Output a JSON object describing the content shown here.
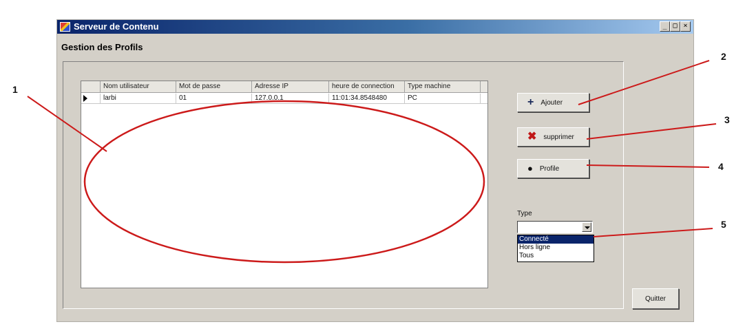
{
  "window": {
    "title": "Serveur de Contenu",
    "subtitle": "Gestion des Profils",
    "controls": [
      "_",
      "□",
      "×"
    ]
  },
  "grid": {
    "columns": [
      "Nom utilisateur",
      "Mot de passe",
      "Adresse IP",
      "heure de connection",
      "Type machine"
    ],
    "rows": [
      [
        "larbi",
        "01",
        "127.0.0.1",
        "11:01:34.8548480",
        "PC"
      ]
    ]
  },
  "buttons": {
    "ajouter": {
      "label": "Ajouter",
      "icon": "plus-icon"
    },
    "supprimer": {
      "label": "supprimer",
      "icon": "x-icon"
    },
    "profile": {
      "label": "Profile",
      "icon": "user-icon"
    },
    "quitter": {
      "label": "Quitter"
    }
  },
  "type_filter": {
    "label": "Type",
    "value": "",
    "options": [
      "Connecté",
      "Hors ligne",
      "Tous"
    ],
    "highlighted": "Connecté"
  },
  "annotations": [
    "1",
    "2",
    "3",
    "4",
    "5"
  ],
  "colors": {
    "annotation": "#cc1a1a",
    "titlebar": "#0a246a",
    "selection": "#0a246a"
  }
}
